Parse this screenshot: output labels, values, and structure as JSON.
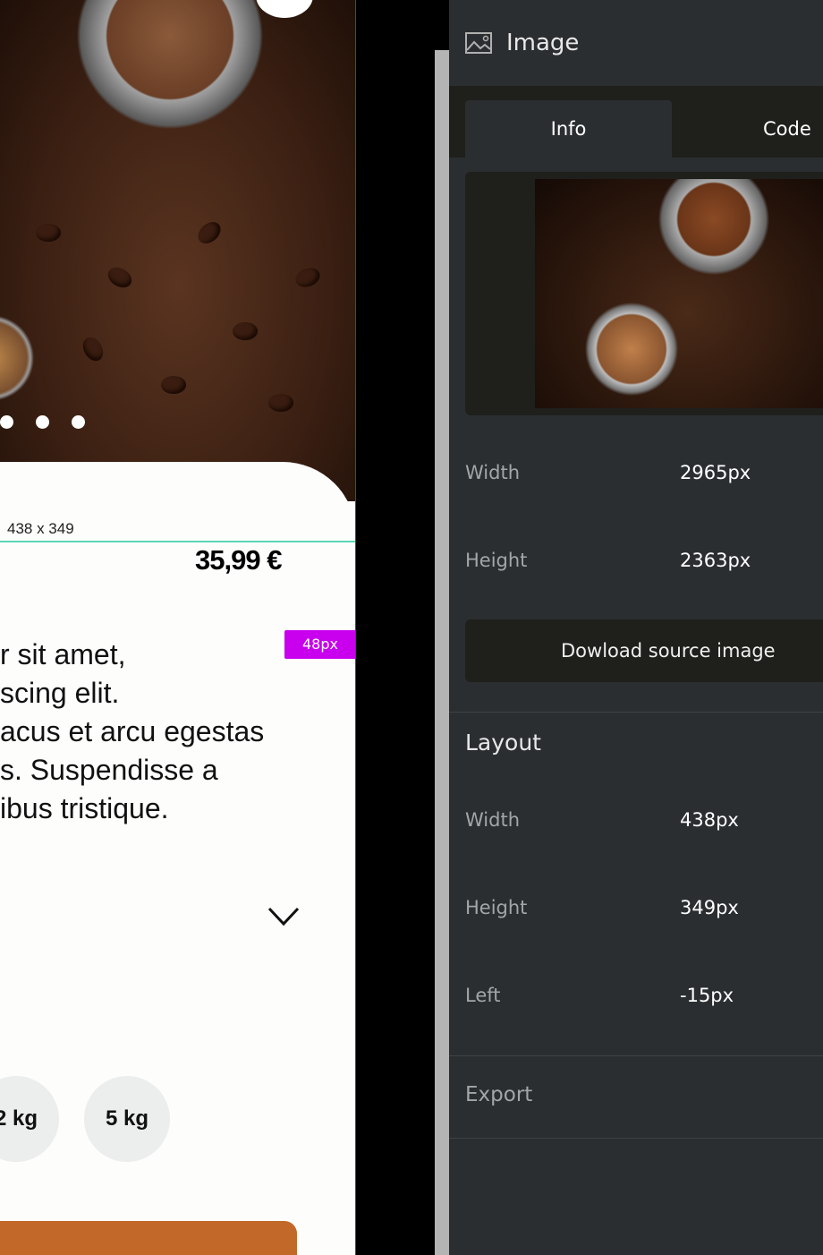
{
  "preview": {
    "dimension_label": "438 x 349",
    "price": "35,99 €",
    "spacing_badge": "48px",
    "description": "r sit amet,\nscing elit.\nacus et arcu egestas\ns. Suspendisse a\nibus tristique.",
    "sizes": [
      "2 kg",
      "5 kg"
    ]
  },
  "panel": {
    "title": "Image",
    "icon": "image-icon",
    "tabs": [
      {
        "label": "Info",
        "active": true
      },
      {
        "label": "Code",
        "active": false
      }
    ],
    "info": {
      "width_label": "Width",
      "width_value": "2965px",
      "height_label": "Height",
      "height_value": "2363px",
      "download_label": "Dowload source image"
    },
    "layout": {
      "title": "Layout",
      "width_label": "Width",
      "width_value": "438px",
      "height_label": "Height",
      "height_value": "349px",
      "left_label": "Left",
      "left_value": "-15px"
    },
    "export_label": "Export"
  },
  "colors": {
    "accent_guide": "#5dd6b6",
    "spacing_badge": "#c800ee",
    "cta": "#c2692a",
    "panel_bg": "#2b2e31"
  }
}
